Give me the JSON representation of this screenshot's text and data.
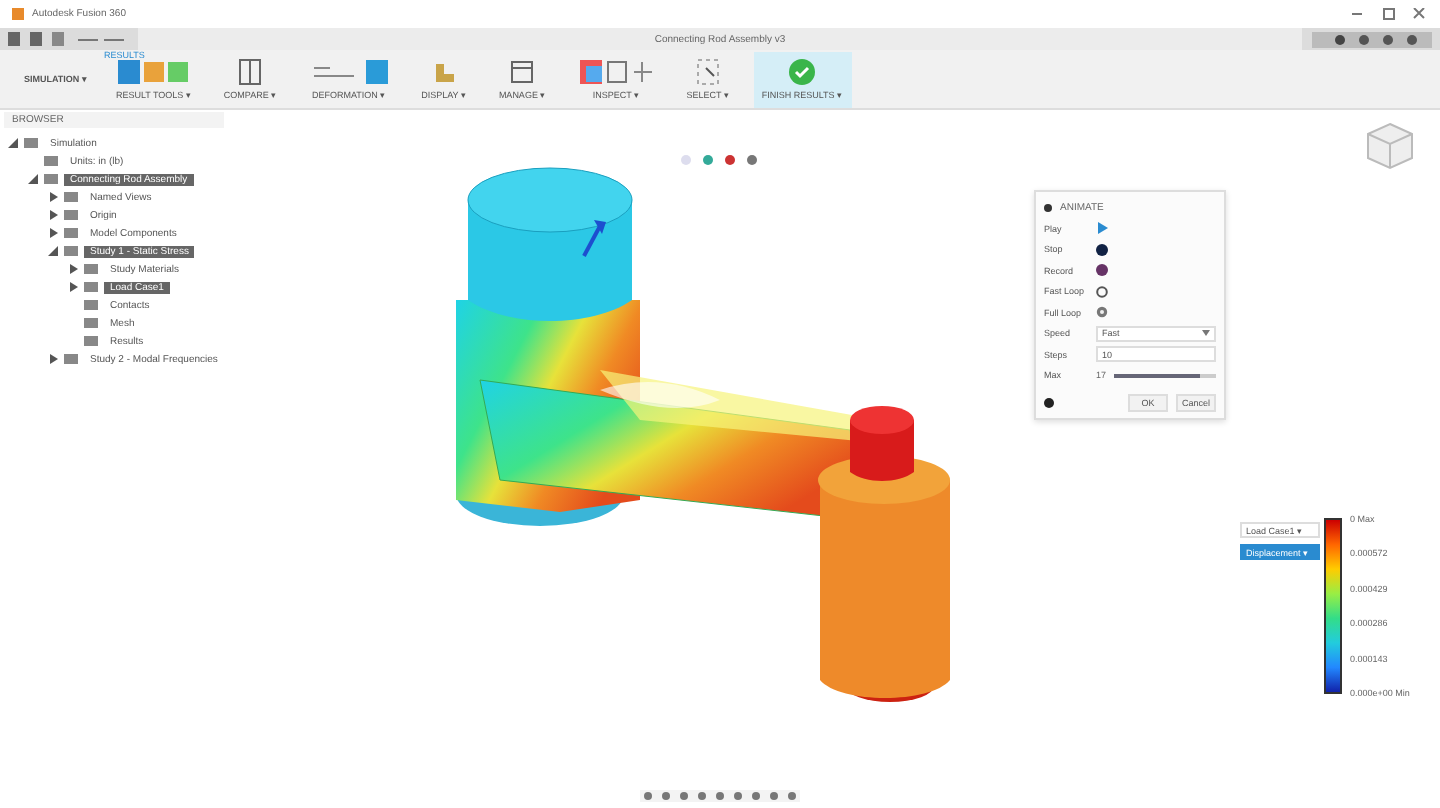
{
  "window": {
    "title": "Autodesk Fusion 360",
    "document": "Connecting Rod Assembly v3"
  },
  "workspace": "SIMULATION ▾",
  "ribbon_tab": "RESULTS",
  "toolbar": [
    {
      "label": "RESULT TOOLS ▾",
      "selected": false
    },
    {
      "label": "COMPARE ▾",
      "selected": false
    },
    {
      "label": "DEFORMATION ▾",
      "selected": false
    },
    {
      "label": "DISPLAY ▾",
      "selected": false
    },
    {
      "label": "MANAGE ▾",
      "selected": false
    },
    {
      "label": "INSPECT ▾",
      "selected": false
    },
    {
      "label": "SELECT ▾",
      "selected": false
    },
    {
      "label": "FINISH RESULTS ▾",
      "selected": true
    }
  ],
  "browser": {
    "title": "BROWSER",
    "tree": [
      {
        "label": "Simulation",
        "expanded": true,
        "selected": false,
        "children": [
          {
            "label": "Units: in (lb)",
            "selected": false
          },
          {
            "label": "Connecting Rod Assembly",
            "expanded": true,
            "selected": true,
            "children": [
              {
                "label": "Named Views",
                "expanded": false,
                "selected": false
              },
              {
                "label": "Origin",
                "expanded": false,
                "selected": false
              },
              {
                "label": "Model Components",
                "expanded": false,
                "selected": false
              },
              {
                "label": "Study 1 - Static Stress",
                "expanded": true,
                "selected": true,
                "children": [
                  {
                    "label": "Study Materials",
                    "expanded": false,
                    "selected": false
                  },
                  {
                    "label": "Load Case1",
                    "expanded": false,
                    "selected": true
                  },
                  {
                    "label": "Contacts",
                    "selected": false
                  },
                  {
                    "label": "Mesh",
                    "selected": false
                  },
                  {
                    "label": "Results",
                    "selected": false
                  }
                ]
              },
              {
                "label": "Study 2 - Modal Frequencies",
                "expanded": false,
                "selected": false
              }
            ]
          }
        ]
      }
    ]
  },
  "animate": {
    "title": "ANIMATE",
    "rows": [
      {
        "kind": "button",
        "label": "Play"
      },
      {
        "kind": "button",
        "label": "Stop"
      },
      {
        "kind": "button",
        "label": "Record"
      },
      {
        "kind": "button",
        "label": "Fast Loop"
      },
      {
        "kind": "button",
        "label": "Full Loop"
      },
      {
        "kind": "select",
        "label": "Speed",
        "value": "Fast"
      },
      {
        "kind": "input",
        "label": "Steps",
        "value": "10"
      },
      {
        "kind": "slider",
        "label": "Max",
        "value": "17",
        "level": 0.85
      }
    ],
    "buttons": [
      "OK",
      "Cancel"
    ]
  },
  "legend": {
    "load_case": "Load Case1 ▾",
    "result": "Displacement ▾",
    "ticks": [
      "0 Max",
      "0.000572",
      "0.000429",
      "0.000286",
      "0.000143",
      "0.000e+00 Min"
    ]
  }
}
